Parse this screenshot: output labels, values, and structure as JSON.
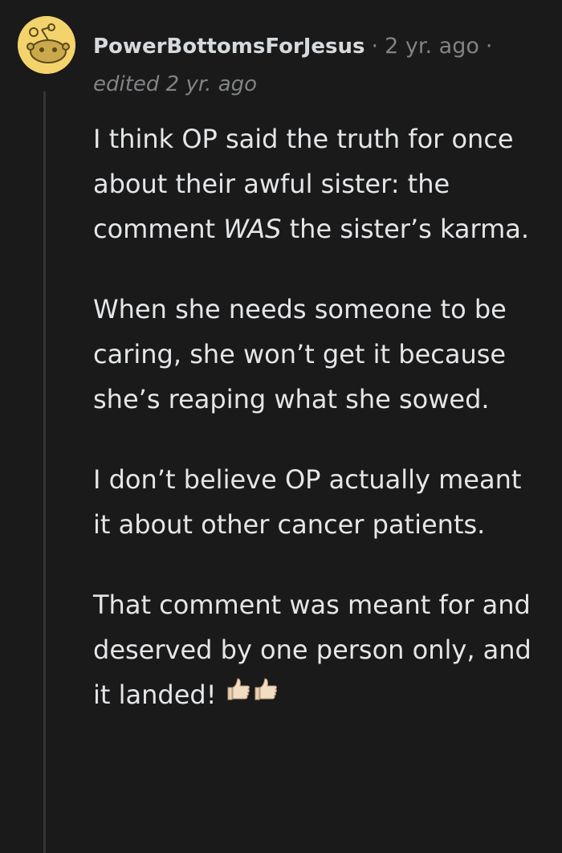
{
  "comment": {
    "username": "PowerBottomsForJesus",
    "separator": "·",
    "time": "2 yr. ago",
    "edited": "edited 2 yr. ago",
    "paragraphs": {
      "p1_a": "I think OP said the truth for once about their awful sister: the comment ",
      "p1_emph": "WAS",
      "p1_b": " the sister’s karma.",
      "p2": "When she needs someone to be caring, she won’t get it because she’s reaping what she sowed.",
      "p3": "I don’t believe OP actually meant it about other cancer patients.",
      "p4": "That comment was meant for and deserved by one person only, and it landed!"
    },
    "emoji": [
      "thumbs-up-icon",
      "thumbs-up-icon"
    ]
  },
  "colors": {
    "background": "#1a1a1b",
    "avatar": "#f3d36b",
    "text": "#e4e6e8",
    "muted": "#818384",
    "thread_line": "#343536"
  }
}
